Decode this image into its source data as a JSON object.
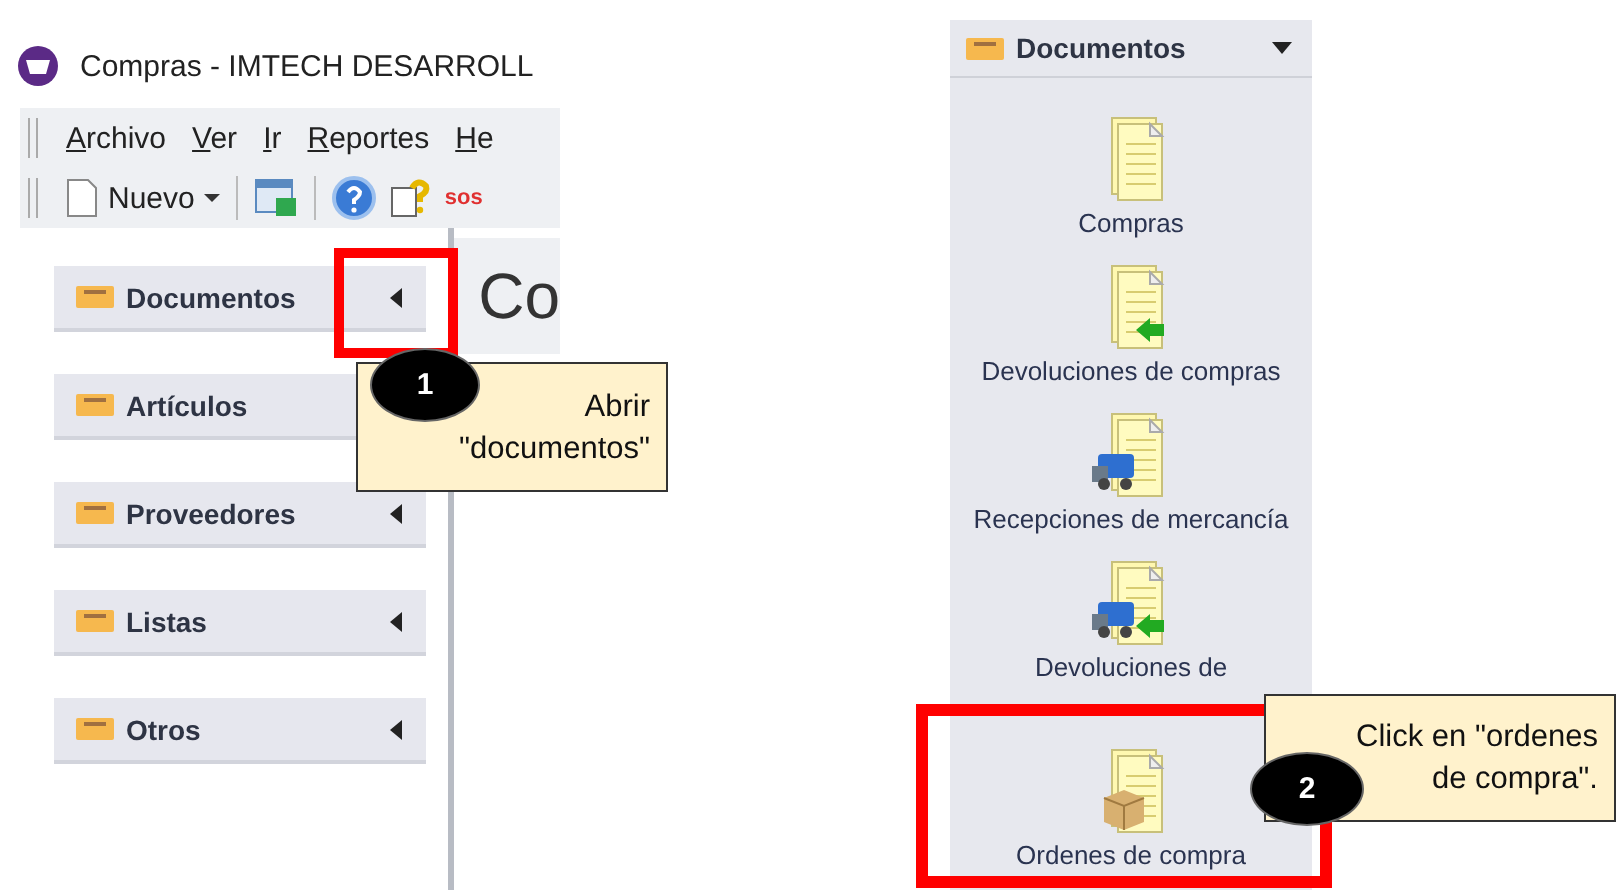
{
  "window": {
    "title": "Compras - IMTECH DESARROLL"
  },
  "menu": [
    {
      "label": "Archivo"
    },
    {
      "label": "Ver"
    },
    {
      "label": "Ir"
    },
    {
      "label": "Reportes"
    },
    {
      "label": "He"
    }
  ],
  "toolbar": {
    "new_button": "Nuevo",
    "sos": "sos"
  },
  "sidebar": {
    "sections": [
      {
        "label": "Documentos",
        "expanded": false
      },
      {
        "label": "Artículos"
      },
      {
        "label": "Proveedores",
        "expanded": false
      },
      {
        "label": "Listas",
        "expanded": false
      },
      {
        "label": "Otros",
        "expanded": false
      }
    ]
  },
  "content": {
    "heading": "Co"
  },
  "documents_panel": {
    "section": {
      "label": "Documentos",
      "expanded": true
    },
    "items": [
      {
        "label": "Compras",
        "kind": "plain"
      },
      {
        "label": "Devoluciones de compras",
        "kind": "return"
      },
      {
        "label": "Recepciones de mercancía",
        "kind": "truck"
      },
      {
        "label": "Devoluciones de",
        "kind": "truck_return"
      },
      {
        "label": "Ordenes de compra",
        "kind": "box"
      }
    ]
  },
  "callouts": [
    {
      "number": "1",
      "lines": [
        "Abrir",
        "\"documentos\""
      ]
    },
    {
      "number": "2",
      "lines": [
        "Click en \"ordenes",
        "de compra\"."
      ]
    }
  ]
}
